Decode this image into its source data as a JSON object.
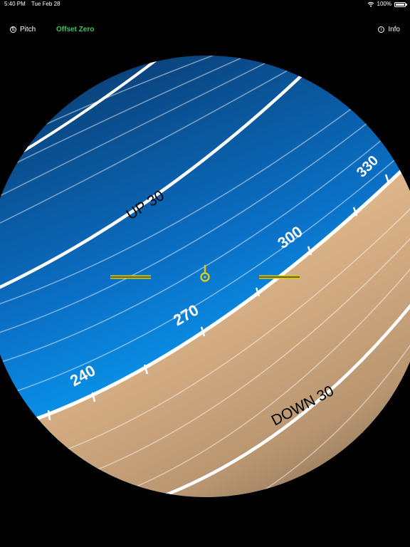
{
  "status": {
    "time": "5:40 PM",
    "date": "Tue Feb 28",
    "battery": "100%",
    "battery_level": 1.0
  },
  "toolbar": {
    "pitch_label": "Pitch",
    "offset_label": "Offset Zero",
    "info_label": "Info",
    "pitch_icon": "pitch-icon",
    "info_icon": "info-icon"
  },
  "sphere": {
    "sky_color": "#0a8fe6",
    "ground_color": "#d6b08a",
    "horizon_labels": [
      "240",
      "270",
      "300",
      "330"
    ],
    "up_label": "UP 30",
    "down_label": "DOWN 30",
    "reticle_color": "#d8c81e"
  }
}
